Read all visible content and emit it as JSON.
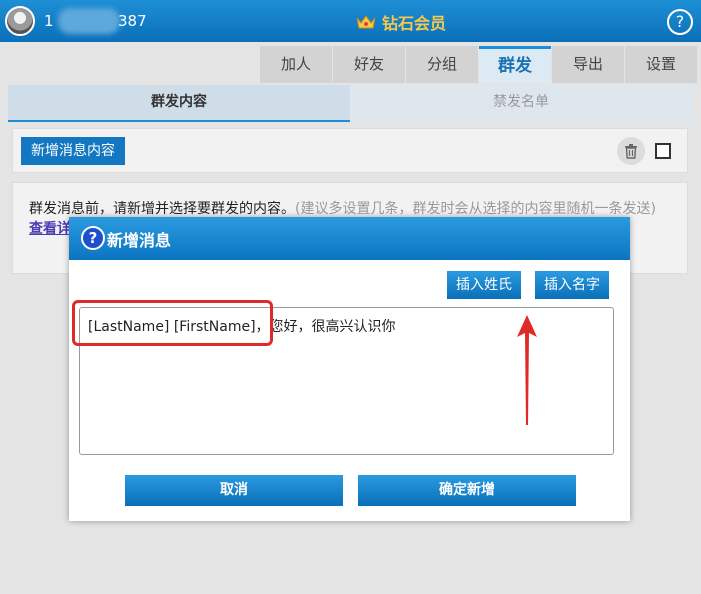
{
  "header": {
    "user_id_start": "1",
    "user_id_end": "387",
    "vip_label": "钻石会员",
    "help_label": "?"
  },
  "nav": {
    "tabs": [
      {
        "label": "加人"
      },
      {
        "label": "好友"
      },
      {
        "label": "分组"
      },
      {
        "label": "群发"
      },
      {
        "label": "导出"
      },
      {
        "label": "设置"
      }
    ]
  },
  "subtabs": {
    "content": "群发内容",
    "blocklist": "禁发名单"
  },
  "toolbar": {
    "add_content": "新增消息内容"
  },
  "info": {
    "main": "群发消息前，请新增并选择要群发的内容。",
    "tip": "(建议多设置几条，群发时会从选择的内容里随机一条发送)",
    "link": "查看详"
  },
  "dialog": {
    "icon": "?",
    "title": "新增消息",
    "insert_lastname": "插入姓氏",
    "insert_firstname": "插入名字",
    "message": "[LastName] [FirstName]，您好，很高兴认识你",
    "cancel": "取消",
    "confirm": "确定新增"
  },
  "colors": {
    "accent": "#1477c1",
    "annotation": "#e02a2a",
    "vip_gold": "#f7c84a"
  }
}
